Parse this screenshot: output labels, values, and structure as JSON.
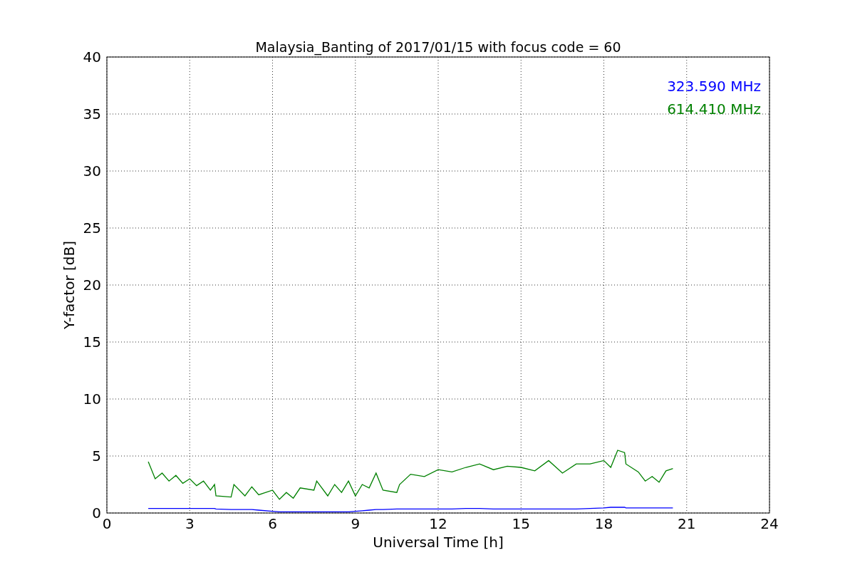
{
  "chart_data": {
    "type": "line",
    "title": "Malaysia_Banting of 2017/01/15 with focus code = 60",
    "xlabel": "Universal Time [h]",
    "ylabel": "Y-factor [dB]",
    "x": [
      1.5,
      1.75,
      2.0,
      2.25,
      2.5,
      2.75,
      3.0,
      3.25,
      3.5,
      3.75,
      3.9,
      3.95,
      4.5,
      4.6,
      5.0,
      5.25,
      5.5,
      6.0,
      6.25,
      6.5,
      6.75,
      7.0,
      7.5,
      7.6,
      8.0,
      8.25,
      8.5,
      8.75,
      9.0,
      9.25,
      9.5,
      9.75,
      10.0,
      10.5,
      10.6,
      11.0,
      11.5,
      12.0,
      12.5,
      13.0,
      13.5,
      14.0,
      14.5,
      15.0,
      15.5,
      16.0,
      16.5,
      17.0,
      17.5,
      18.0,
      18.25,
      18.5,
      18.75,
      18.8,
      19.25,
      19.5,
      19.75,
      20.0,
      20.25,
      20.5
    ],
    "series": [
      {
        "name": "323.590 MHz",
        "color": "#0000ff",
        "values": [
          0.4,
          0.4,
          0.4,
          0.4,
          0.4,
          0.4,
          0.4,
          0.4,
          0.4,
          0.4,
          0.4,
          0.35,
          0.3,
          0.3,
          0.3,
          0.3,
          0.25,
          0.15,
          0.1,
          0.1,
          0.1,
          0.1,
          0.1,
          0.1,
          0.1,
          0.1,
          0.1,
          0.1,
          0.15,
          0.2,
          0.25,
          0.3,
          0.3,
          0.35,
          0.35,
          0.35,
          0.35,
          0.35,
          0.35,
          0.4,
          0.4,
          0.35,
          0.35,
          0.35,
          0.35,
          0.35,
          0.35,
          0.35,
          0.4,
          0.45,
          0.5,
          0.5,
          0.5,
          0.45,
          0.45,
          0.45,
          0.45,
          0.45,
          0.45,
          0.45
        ]
      },
      {
        "name": "614.410 MHz",
        "color": "#008000",
        "values": [
          4.5,
          3.0,
          3.5,
          2.8,
          3.3,
          2.6,
          3.0,
          2.4,
          2.8,
          2.0,
          2.5,
          1.5,
          1.4,
          2.5,
          1.5,
          2.3,
          1.6,
          2.0,
          1.2,
          1.8,
          1.3,
          2.2,
          2.0,
          2.8,
          1.5,
          2.5,
          1.8,
          2.8,
          1.5,
          2.5,
          2.2,
          3.5,
          2.0,
          1.8,
          2.5,
          3.4,
          3.2,
          3.8,
          3.6,
          4.0,
          4.3,
          3.8,
          4.1,
          4.0,
          3.7,
          4.6,
          3.5,
          4.3,
          4.3,
          4.6,
          4.0,
          5.5,
          5.3,
          4.3,
          3.6,
          2.8,
          3.2,
          2.7,
          3.7,
          3.9
        ]
      }
    ],
    "xlim": [
      0,
      24
    ],
    "ylim": [
      0,
      40
    ],
    "xticks": [
      0,
      3,
      6,
      9,
      12,
      15,
      18,
      21,
      24
    ],
    "yticks": [
      0,
      5,
      10,
      15,
      20,
      25,
      30,
      35,
      40
    ],
    "grid": true
  }
}
